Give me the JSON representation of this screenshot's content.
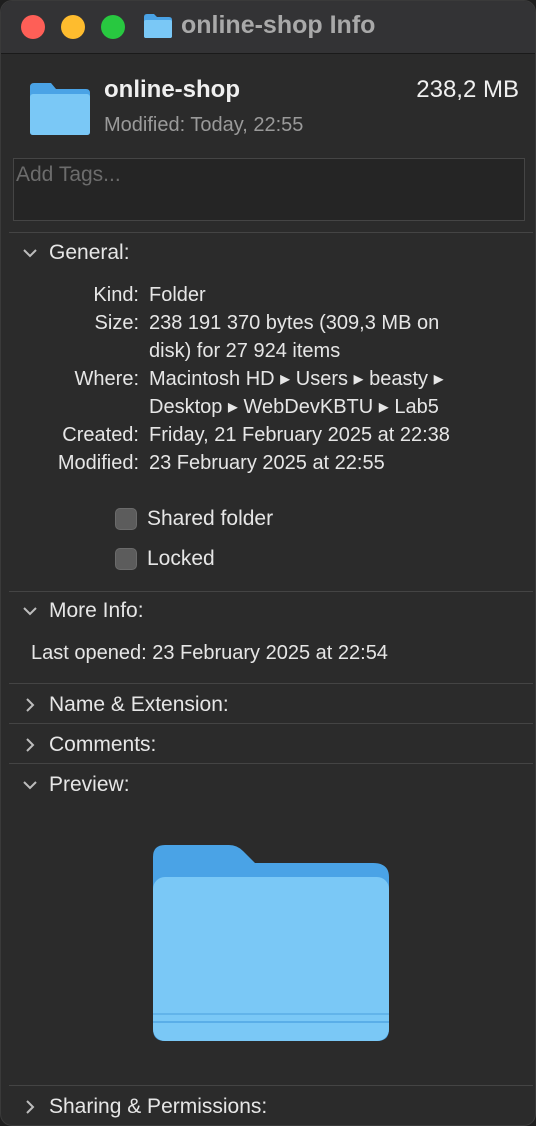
{
  "window": {
    "title": "online-shop Info"
  },
  "header": {
    "name": "online-shop",
    "size": "238,2 MB",
    "modified": "Modified: Today, 22:55"
  },
  "tags": {
    "placeholder": "Add Tags..."
  },
  "general": {
    "heading": "General:",
    "kind_label": "Kind:",
    "kind_value": "Folder",
    "size_label": "Size:",
    "size_line1": "238 191 370 bytes (309,3 MB on",
    "size_line2": "disk) for 27 924 items",
    "where_label": "Where:",
    "where_line1": "Macintosh HD ▸ Users ▸ beasty ▸",
    "where_line2": "Desktop ▸ WebDevKBTU ▸ Lab5",
    "created_label": "Created:",
    "created_value": "Friday, 21 February 2025 at 22:38",
    "modified_label": "Modified:",
    "modified_value": "23 February 2025 at 22:55",
    "shared_folder": "Shared folder",
    "locked": "Locked"
  },
  "more_info": {
    "heading": "More Info:",
    "last_opened": "Last opened: 23 February 2025 at 22:54"
  },
  "sections": {
    "name_extension": "Name & Extension:",
    "comments": "Comments:",
    "preview": "Preview:",
    "sharing": "Sharing & Permissions:"
  },
  "colors": {
    "folder_light": "#7ac8f6",
    "folder_dark": "#4aa3e6",
    "close": "#fe5f57",
    "minimize": "#febc2e",
    "zoom": "#28c840"
  }
}
